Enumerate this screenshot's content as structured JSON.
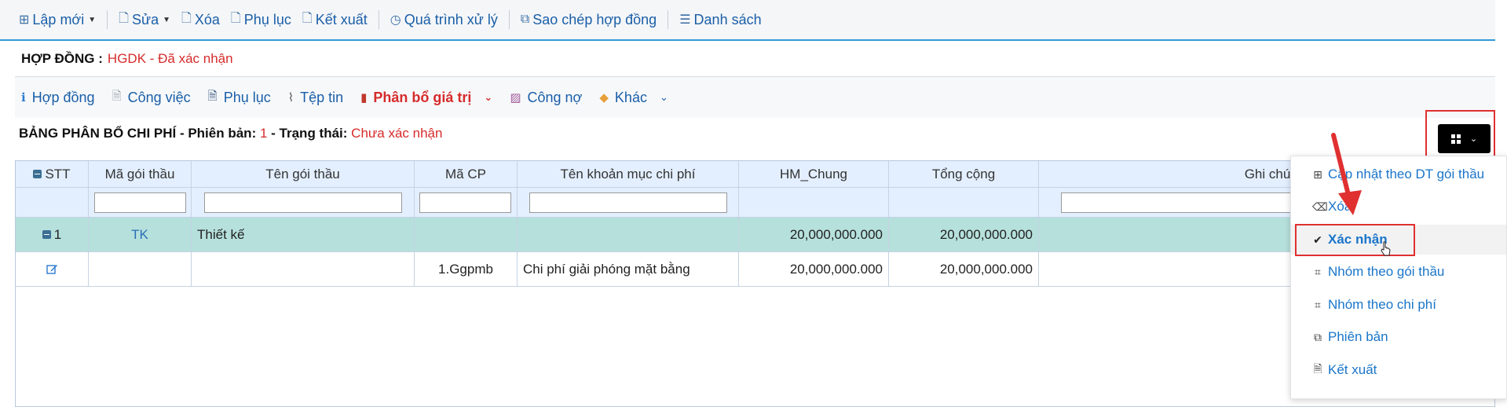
{
  "toolbar": {
    "items": [
      {
        "label": "Lập mới",
        "icon": "plus-square-icon",
        "caret": true
      },
      {
        "label": "Sửa",
        "icon": "edit-doc-icon",
        "caret": true
      },
      {
        "label": "Xóa",
        "icon": "delete-doc-icon"
      },
      {
        "label": "Phụ lục",
        "icon": "attachment-doc-icon"
      },
      {
        "label": "Kết xuất",
        "icon": "export-icon"
      },
      {
        "label": "Quá trình xử lý",
        "icon": "history-icon"
      },
      {
        "label": "Sao chép hợp đồng",
        "icon": "copy-icon"
      },
      {
        "label": "Danh sách",
        "icon": "list-icon"
      }
    ]
  },
  "header": {
    "label": "HỢP ĐỒNG :",
    "value": "HGDK - Đã xác nhận"
  },
  "tabs": [
    {
      "label": "Hợp đồng",
      "icon": "info-icon"
    },
    {
      "label": "Công việc",
      "icon": "document-icon"
    },
    {
      "label": "Phụ lục",
      "icon": "doc-lines-icon"
    },
    {
      "label": "Tệp tin",
      "icon": "paperclip-icon"
    },
    {
      "label": "Phân bổ giá trị",
      "icon": "bar-chart-icon",
      "active": true
    },
    {
      "label": "Công nợ",
      "icon": "chart-line-icon"
    },
    {
      "label": "Khác",
      "icon": "tag-icon"
    }
  ],
  "table_title": {
    "prefix": "BẢNG PHÂN BỔ CHI PHÍ - Phiên bản: ",
    "version": "1",
    "status_label": " - Trạng thái: ",
    "status": "Chưa xác nhận"
  },
  "grid": {
    "columns": [
      "STT",
      "Mã gói thầu",
      "Tên gói thầu",
      "Mã CP",
      "Tên khoản mục chi phí",
      "HM_Chung",
      "Tổng cộng",
      "Ghi chú"
    ],
    "group_row": {
      "stt": "1",
      "ma_goi_thau": "TK",
      "ten_goi_thau": "Thiết kế",
      "hm_chung": "20,000,000.000",
      "tong_cong": "20,000,000.000"
    },
    "detail_row": {
      "ma_cp": "1.Ggpmb",
      "ten_khoan_muc": "Chi phí giải phóng mặt bằng",
      "hm_chung": "20,000,000.000",
      "tong_cong": "20,000,000.000"
    }
  },
  "menu": {
    "items": [
      {
        "label": "Cập nhật theo DT gói thầu",
        "icon": "plus-box-icon"
      },
      {
        "label": "Xóa",
        "icon": "backspace-icon"
      },
      {
        "label": "Xác nhận",
        "icon": "check-icon"
      },
      {
        "label": "Nhóm theo gói thầu",
        "icon": "crop-icon"
      },
      {
        "label": "Nhóm theo chi phí",
        "icon": "crop-icon"
      },
      {
        "label": "Phiên bản",
        "icon": "copy-icon"
      },
      {
        "label": "Kết xuất",
        "icon": "excel-icon"
      }
    ]
  },
  "colors": {
    "accent_red": "#d62b2b",
    "link_blue": "#1a5fa8",
    "group_row_bg": "#b6e0dc",
    "header_bg": "#e3efff"
  }
}
